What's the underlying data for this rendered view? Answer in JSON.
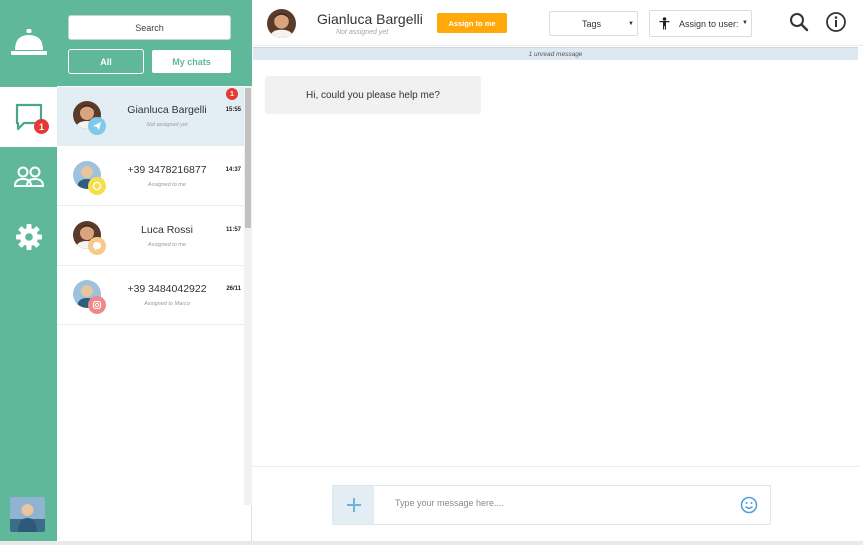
{
  "rail": {
    "badge_count": "1",
    "items": [
      {
        "icon": "bell-icon"
      },
      {
        "icon": "chat-icon"
      },
      {
        "icon": "users-icon"
      },
      {
        "icon": "gear-icon"
      }
    ]
  },
  "list": {
    "search_label": "Search",
    "filter_all": "All",
    "filter_mine": "My chats",
    "chats": [
      {
        "name": "Gianluca Bargelli",
        "sub": "Not assigned yet",
        "time": "15:55",
        "unread": "1",
        "channel": "telegram",
        "channel_color": "#7fc9ec"
      },
      {
        "name": "+39 3478216877",
        "sub": "Assigned to me",
        "time": "14:37",
        "channel": "whatsapp",
        "channel_color": "#f4e04d"
      },
      {
        "name": "Luca Rossi",
        "sub": "Assigned to me",
        "time": "11:57",
        "channel": "messenger",
        "channel_color": "#f7c98a"
      },
      {
        "name": "+39 3484042922",
        "sub": "Assigned to Marco",
        "time": "26/11",
        "channel": "instagram",
        "channel_color": "#f08a8a"
      }
    ]
  },
  "topbar": {
    "name": "Gianluca Bargelli",
    "sub": "Not assigned yet",
    "assign_me": "Assign to me",
    "tags": "Tags",
    "assign_user": "Assign to user:"
  },
  "conversation": {
    "unread_banner": "1 unread message",
    "message": "Hi, could you please help me?"
  },
  "composer": {
    "placeholder": "Type your message here...."
  },
  "colors": {
    "accent": "#5fb89a",
    "orange": "#ffa90a",
    "badge": "#e53935"
  }
}
